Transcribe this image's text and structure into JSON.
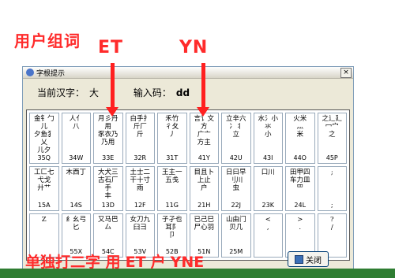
{
  "annotations": {
    "top_label": "用户组词",
    "et": "ET",
    "yn": "YN",
    "bottom_prefix": "单独打二字 用",
    "bottom_et": "ET",
    "bottom_mid": "户",
    "bottom_yne": "YNE"
  },
  "window": {
    "title": "字根提示",
    "close_glyph": "×"
  },
  "info": {
    "hanzi_label": "当前汉字：",
    "hanzi_value": "大",
    "bianma_label": "输入码：",
    "bianma_value": "dd"
  },
  "keys": [
    {
      "radicals": "金钅勹儿\n夕鱼犭乂\n儿夕",
      "code": "35Q"
    },
    {
      "radicals": "人亻\n八",
      "code": "34W"
    },
    {
      "radicals": "月彡丹用\n豕衣乃\n乃用",
      "code": "33E"
    },
    {
      "radicals": "白手扌\n斤厂\n斤",
      "code": "32R"
    },
    {
      "radicals": "禾竹\n彳夂\n丿",
      "code": "31T"
    },
    {
      "radicals": "言讠文方\n广亠\n方主",
      "code": "41Y"
    },
    {
      "radicals": "立辛六\n冫丬\n立",
      "code": "42U"
    },
    {
      "radicals": "水氵小\n氺\n小",
      "code": "43I"
    },
    {
      "radicals": "火米\n灬\n米",
      "code": "44O"
    },
    {
      "radicals": "之辶廴\n冖宀\n之",
      "code": "45P"
    },
    {
      "radicals": "工匚七\n弋戈\n廾艹",
      "code": "15A"
    },
    {
      "radicals": "木西丁",
      "code": "14S"
    },
    {
      "radicals": "大犬三\n古石厂\n手\n丰",
      "code": "13D"
    },
    {
      "radicals": "土士二\n干十寸\n雨",
      "code": "12F"
    },
    {
      "radicals": "王主一\n五戋",
      "code": "11G"
    },
    {
      "radicals": "目且卜\n上止\n户",
      "code": "21H"
    },
    {
      "radicals": "日曰早\n刂川\n虫",
      "code": "22J"
    },
    {
      "radicals": "口川",
      "code": "23K"
    },
    {
      "radicals": "田甲四\n车力皿\n罒",
      "code": "24L"
    },
    {
      "radicals": ";",
      "code": ";"
    },
    {
      "radicals": "Z",
      "code": ""
    },
    {
      "radicals": "纟幺弓\n匕",
      "code": "55X"
    },
    {
      "radicals": "又马巴\n厶",
      "code": "54C"
    },
    {
      "radicals": "女刀九\n臼彐",
      "code": "53V"
    },
    {
      "radicals": "子孑也\n耳阝\n卩",
      "code": "52B"
    },
    {
      "radicals": "已己巳\n尸心羽",
      "code": "51N"
    },
    {
      "radicals": "山由门\n贝几",
      "code": "25M"
    },
    {
      "radicals": "<\n,",
      "code": ""
    },
    {
      "radicals": ">\n.",
      "code": ""
    },
    {
      "radicals": "?\n/",
      "code": ""
    }
  ],
  "close_button": {
    "label": "关闭"
  },
  "colors": {
    "annotation": "#ff2b2b",
    "dialog": "#ece9d8"
  }
}
